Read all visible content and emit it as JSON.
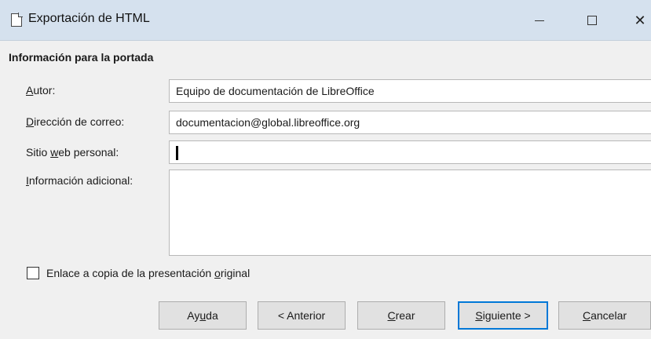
{
  "window": {
    "title": "Exportación de HTML",
    "minimize_icon": "minimize-icon",
    "maximize_icon": "maximize-icon",
    "close_icon": "close-icon",
    "close_glyph": "✕"
  },
  "section": {
    "title": "Información para la portada"
  },
  "fields": {
    "author": {
      "label_mnemonic": "A",
      "label_rest": "utor:",
      "value": "Equipo de documentación de LibreOffice"
    },
    "email": {
      "label_mnemonic": "D",
      "label_rest": "irección de correo:",
      "value": "documentacion@global.libreoffice.org"
    },
    "website": {
      "label_pre": "Sitio ",
      "label_mnemonic": "w",
      "label_rest": "eb personal:",
      "value": ""
    },
    "info": {
      "label_mnemonic": "I",
      "label_rest": "nformación adicional:",
      "value": ""
    }
  },
  "checkbox": {
    "label_pre": "Enlace a copia de la presentación ",
    "label_mnemonic": "o",
    "label_rest": "riginal",
    "checked": false
  },
  "buttons": {
    "help": {
      "pre": "Ay",
      "mnemonic": "u",
      "rest": "da"
    },
    "previous": {
      "label": "< Anterior"
    },
    "create": {
      "pre": "",
      "mnemonic": "C",
      "rest": "rear"
    },
    "next": {
      "pre": "",
      "mnemonic": "S",
      "rest": "iguiente >"
    },
    "cancel": {
      "pre": "",
      "mnemonic": "C",
      "rest": "ancelar"
    }
  }
}
